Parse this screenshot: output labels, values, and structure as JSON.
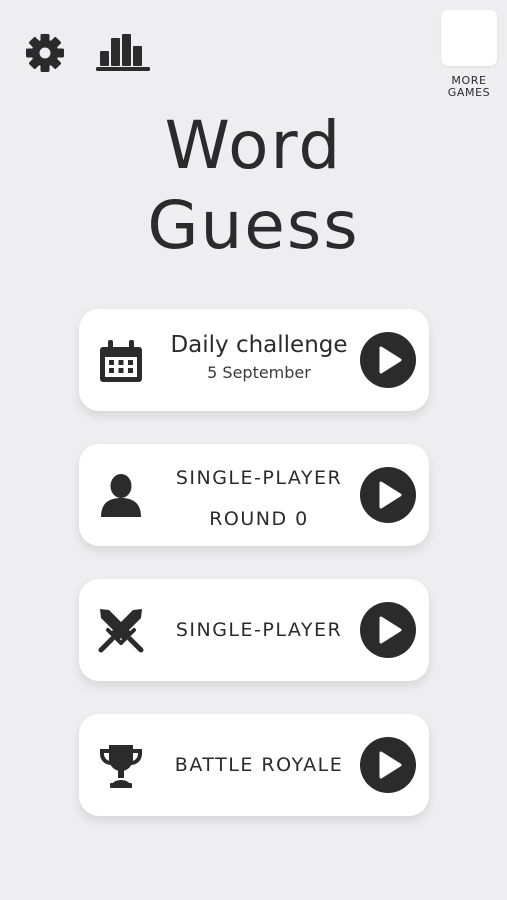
{
  "header": {
    "more_games_line1": "MORE",
    "more_games_line2": "GAMES"
  },
  "title": {
    "line1": "Word",
    "line2": "Guess"
  },
  "menu": [
    {
      "icon": "calendar-icon",
      "title": "Daily challenge",
      "subtitle": "5 September"
    },
    {
      "icon": "person-icon",
      "title": "SINGLE-PLAYER",
      "subtitle": "ROUND 0"
    },
    {
      "icon": "crossed-swords-icon",
      "title": "SINGLE-PLAYER"
    },
    {
      "icon": "trophy-icon",
      "title": "BATTLE ROYALE"
    }
  ],
  "colors": {
    "background": "#eeeef0",
    "card": "#ffffff",
    "ink": "#2b2b2b"
  }
}
